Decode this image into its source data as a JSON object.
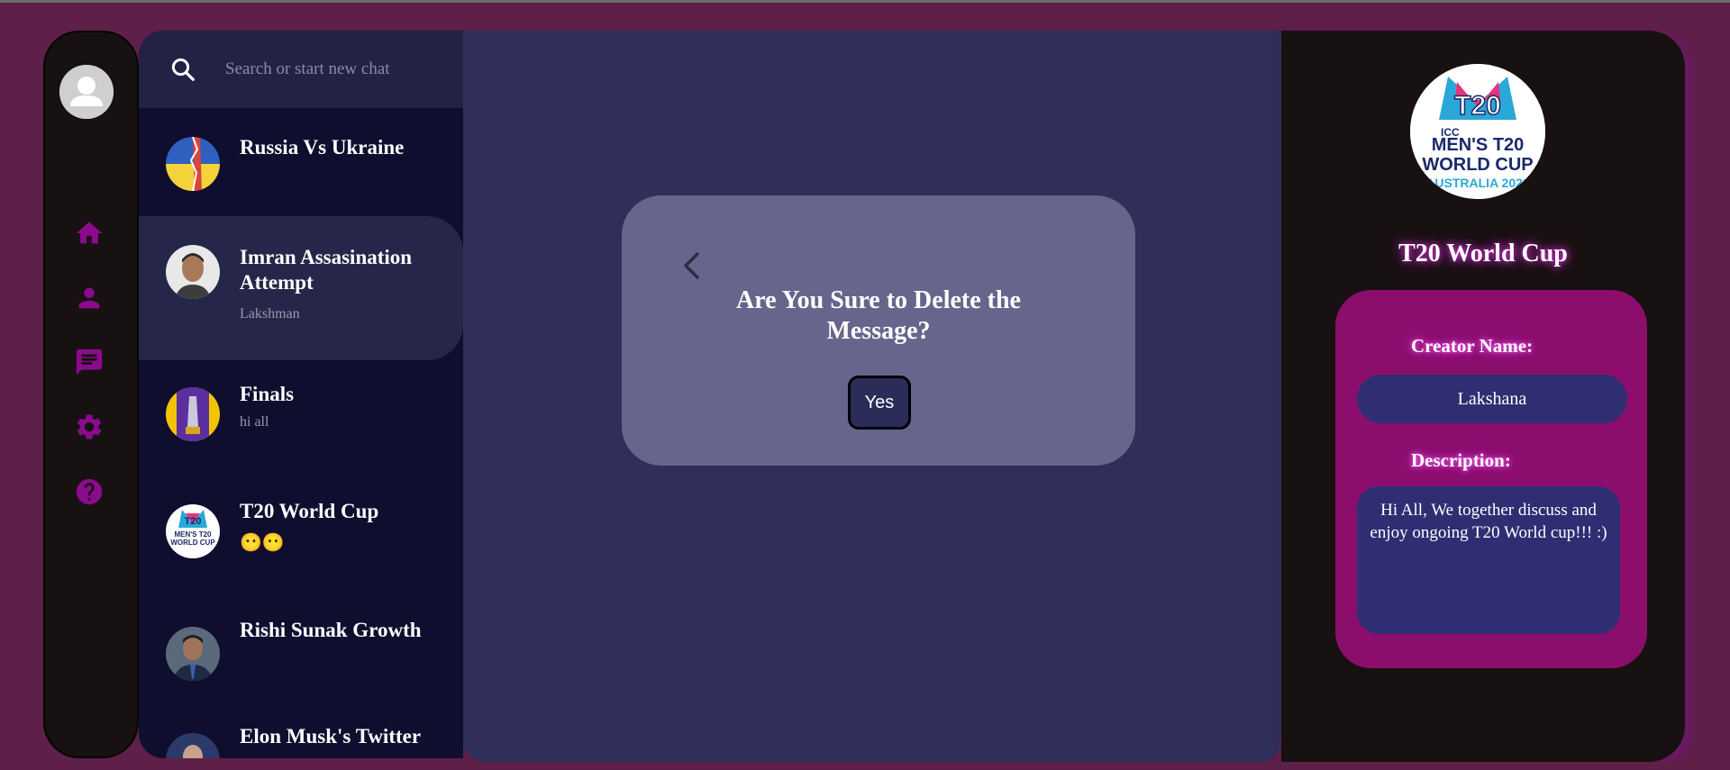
{
  "search": {
    "placeholder": "Search or start new chat"
  },
  "chats": [
    {
      "title": "Russia Vs Ukraine",
      "subtitle": ""
    },
    {
      "title": "Imran Assasination Attempt",
      "subtitle": "Lakshman"
    },
    {
      "title": "Finals",
      "subtitle": "hi all"
    },
    {
      "title": "T20 World Cup",
      "subtitle": "😶😶"
    },
    {
      "title": "Rishi Sunak Growth",
      "subtitle": ""
    },
    {
      "title": "Elon Musk's Twitter",
      "subtitle": ""
    }
  ],
  "modal": {
    "title": "Are You Sure to Delete the Message?",
    "yes_label": "Yes"
  },
  "group": {
    "name": "T20 World Cup",
    "creator_label": "Creator Name:",
    "creator_value": "Lakshana",
    "description_label": "Description:",
    "description_value": "Hi All, We together discuss and enjoy ongoing T20 World cup!!! :)"
  },
  "colors": {
    "background": "#5e1f48",
    "rail": "#171111",
    "chatlist": "#0f0e2f",
    "main": "#2f2f59",
    "modal": "#66658b",
    "accent_icon": "#8c0a8c",
    "details_card": "#8b0e6d",
    "field_box": "#2f2e73"
  },
  "icons": [
    "user-avatar-icon",
    "home-icon",
    "person-icon",
    "chat-icon",
    "settings-icon",
    "help-icon",
    "search-icon",
    "chevron-left-icon"
  ]
}
